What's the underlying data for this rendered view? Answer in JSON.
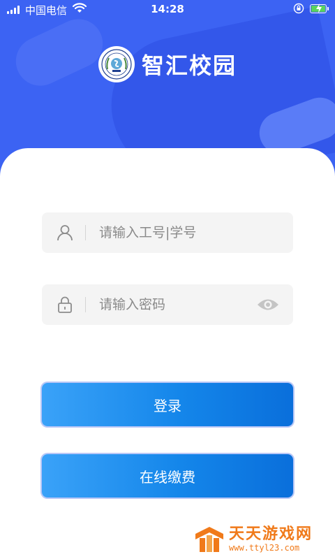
{
  "status_bar": {
    "carrier": "中国电信",
    "time": "14:28"
  },
  "header": {
    "app_title": "智汇校园"
  },
  "login_form": {
    "username_placeholder": "请输入工号|学号",
    "username_value": "",
    "password_placeholder": "请输入密码",
    "password_value": ""
  },
  "actions": {
    "login_label": "登录",
    "payment_label": "在线缴费"
  },
  "watermark": {
    "title": "天天游戏网",
    "url": "www.ttyl23.com"
  },
  "colors": {
    "header_blue": "#3c63f3",
    "button_gradient_start": "#3aa2f8",
    "button_gradient_end": "#0a6fdb",
    "watermark_orange": "#f07a1a"
  }
}
